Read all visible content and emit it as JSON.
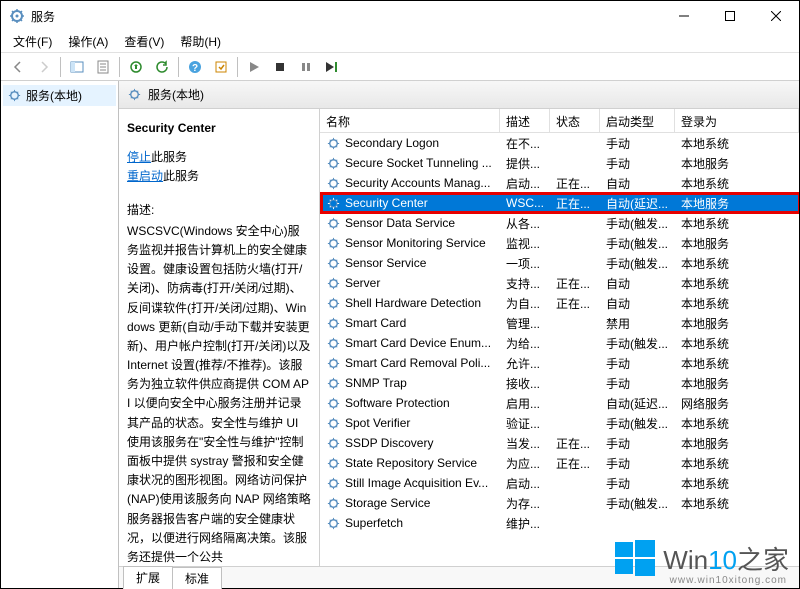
{
  "window": {
    "title": "服务"
  },
  "menus": {
    "file": "文件(F)",
    "action": "操作(A)",
    "view": "查看(V)",
    "help": "帮助(H)"
  },
  "tree": {
    "root": "服务(本地)"
  },
  "pane": {
    "header": "服务(本地)",
    "selected_name": "Security Center",
    "link_stop": "停止",
    "link_restart": "重启动",
    "link_suffix": "此服务",
    "desc_label": "描述:",
    "desc_text": "WSCSVC(Windows 安全中心)服务监视并报告计算机上的安全健康设置。健康设置包括防火墙(打开/关闭)、防病毒(打开/关闭/过期)、反间谍软件(打开/关闭/过期)、Windows 更新(自动/手动下载并安装更新)、用户帐户控制(打开/关闭)以及 Internet 设置(推荐/不推荐)。该服务为独立软件供应商提供 COM API 以便向安全中心服务注册并记录其产品的状态。安全性与维护 UI 使用该服务在\"安全性与维护\"控制面板中提供 systray 警报和安全健康状况的图形视图。网络访问保护(NAP)使用该服务向 NAP 网络策略服务器报告客户端的安全健康状况，以便进行网络隔离决策。该服务还提供一个公共"
  },
  "columns": {
    "name": "名称",
    "desc": "描述",
    "status": "状态",
    "startup": "启动类型",
    "logon": "登录为"
  },
  "rows": [
    {
      "n": "Secondary Logon",
      "d": "在不...",
      "s": "",
      "t": "手动",
      "l": "本地系统"
    },
    {
      "n": "Secure Socket Tunneling ...",
      "d": "提供...",
      "s": "",
      "t": "手动",
      "l": "本地服务"
    },
    {
      "n": "Security Accounts Manag...",
      "d": "启动...",
      "s": "正在...",
      "t": "自动",
      "l": "本地系统"
    },
    {
      "n": "Security Center",
      "d": "WSC...",
      "s": "正在...",
      "t": "自动(延迟...",
      "l": "本地服务",
      "sel": true
    },
    {
      "n": "Sensor Data Service",
      "d": "从各...",
      "s": "",
      "t": "手动(触发...",
      "l": "本地系统"
    },
    {
      "n": "Sensor Monitoring Service",
      "d": "监视...",
      "s": "",
      "t": "手动(触发...",
      "l": "本地服务"
    },
    {
      "n": "Sensor Service",
      "d": "一项...",
      "s": "",
      "t": "手动(触发...",
      "l": "本地系统"
    },
    {
      "n": "Server",
      "d": "支持...",
      "s": "正在...",
      "t": "自动",
      "l": "本地系统"
    },
    {
      "n": "Shell Hardware Detection",
      "d": "为自...",
      "s": "正在...",
      "t": "自动",
      "l": "本地系统"
    },
    {
      "n": "Smart Card",
      "d": "管理...",
      "s": "",
      "t": "禁用",
      "l": "本地服务"
    },
    {
      "n": "Smart Card Device Enum...",
      "d": "为给...",
      "s": "",
      "t": "手动(触发...",
      "l": "本地系统"
    },
    {
      "n": "Smart Card Removal Poli...",
      "d": "允许...",
      "s": "",
      "t": "手动",
      "l": "本地系统"
    },
    {
      "n": "SNMP Trap",
      "d": "接收...",
      "s": "",
      "t": "手动",
      "l": "本地服务"
    },
    {
      "n": "Software Protection",
      "d": "启用...",
      "s": "",
      "t": "自动(延迟...",
      "l": "网络服务"
    },
    {
      "n": "Spot Verifier",
      "d": "验证...",
      "s": "",
      "t": "手动(触发...",
      "l": "本地系统"
    },
    {
      "n": "SSDP Discovery",
      "d": "当发...",
      "s": "正在...",
      "t": "手动",
      "l": "本地服务"
    },
    {
      "n": "State Repository Service",
      "d": "为应...",
      "s": "正在...",
      "t": "手动",
      "l": "本地系统"
    },
    {
      "n": "Still Image Acquisition Ev...",
      "d": "启动...",
      "s": "",
      "t": "手动",
      "l": "本地系统"
    },
    {
      "n": "Storage Service",
      "d": "为存...",
      "s": "",
      "t": "手动(触发...",
      "l": "本地系统"
    },
    {
      "n": "Superfetch",
      "d": "维护...",
      "s": "",
      "t": "",
      "l": ""
    }
  ],
  "tabs": {
    "ext": "扩展",
    "std": "标准"
  },
  "watermark": {
    "text_pre": "Win",
    "text_hl": "10",
    "text_post": "之家",
    "url": "www.win10xitong.com"
  }
}
